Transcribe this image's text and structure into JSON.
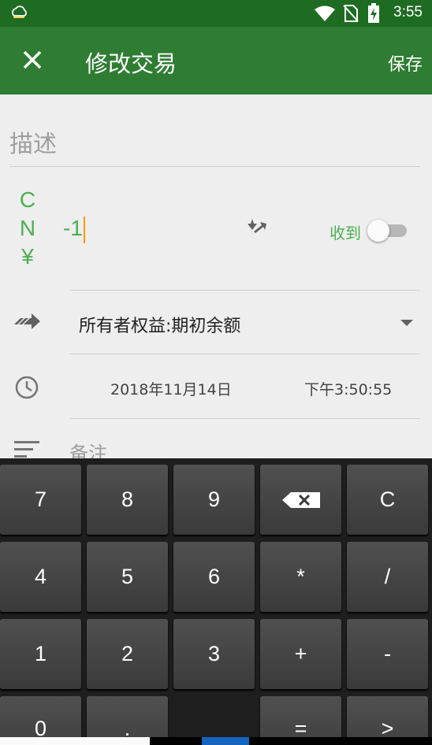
{
  "status_bar": {
    "time": "3:55",
    "icons": [
      "weather-icon",
      "wifi-icon",
      "no-sim-icon",
      "battery-charging-icon"
    ]
  },
  "app_bar": {
    "close_icon": "close-icon",
    "title": "修改交易",
    "save_label": "保存"
  },
  "form": {
    "description_placeholder": "描述",
    "currency": [
      "C",
      "N",
      "¥"
    ],
    "amount": "-1",
    "received_label": "收到",
    "received_toggle_on": false,
    "account": "所有者权益:期初余额",
    "date": "2018年11月14日",
    "time": "下午3:50:55",
    "notes_placeholder": "备注"
  },
  "keyboard": {
    "rows": [
      [
        "7",
        "8",
        "9",
        "backspace",
        "C"
      ],
      [
        "4",
        "5",
        "6",
        "*",
        "/"
      ],
      [
        "1",
        "2",
        "3",
        "+",
        "-"
      ],
      [
        "0",
        ".",
        "",
        "=",
        ">"
      ]
    ]
  },
  "colors": {
    "status_bar": "#1e6b22",
    "app_bar": "#2e7d32",
    "accent_green": "#4caf50",
    "cursor": "#ff9800"
  }
}
